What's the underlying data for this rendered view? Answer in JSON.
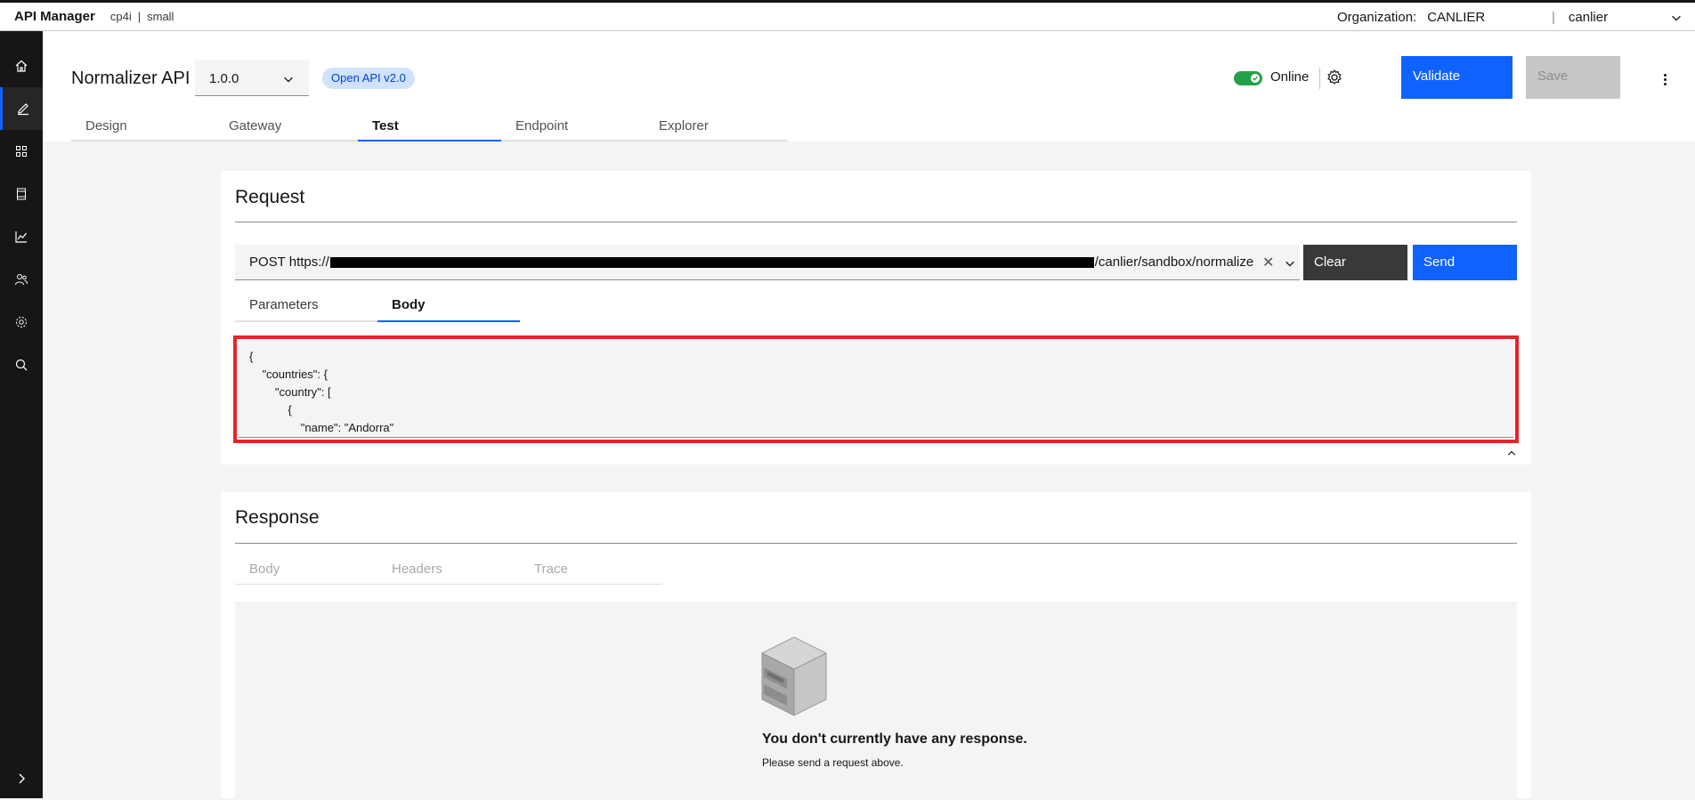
{
  "header": {
    "brand": "API Manager",
    "context": "cp4i",
    "context_sep": "|",
    "size": "small",
    "org_label": "Organization:",
    "org_value": "CANLIER",
    "user_sep": "|",
    "user": "canlier"
  },
  "rail": {
    "items": [
      "home-icon",
      "edit-icon",
      "apps-icon",
      "catalog-icon",
      "analytics-icon",
      "members-icon",
      "settings-icon",
      "search-icon"
    ],
    "active": "edit-icon",
    "expand": "chevron-right-icon"
  },
  "api": {
    "title": "Normalizer API",
    "version": "1.0.0",
    "spec_tag": "Open API v2.0",
    "status": "Online",
    "validate_label": "Validate",
    "save_label": "Save",
    "tabs": [
      "Design",
      "Gateway",
      "Test",
      "Endpoint",
      "Explorer"
    ],
    "active_tab": "Test"
  },
  "request": {
    "title": "Request",
    "url_prefix": "POST https://",
    "url_suffix": "/canlier/sandbox/normalizе",
    "clear_label": "Clear",
    "send_label": "Send",
    "tabs": [
      "Parameters",
      "Body"
    ],
    "active_tab": "Body",
    "body_lines": [
      "{",
      "    \"countries\": {",
      "        \"country\": [",
      "            {",
      "                \"name\": \"Andorra\""
    ]
  },
  "response": {
    "title": "Response",
    "tabs": [
      "Body",
      "Headers",
      "Trace"
    ],
    "empty_title": "You don't currently have any response.",
    "empty_sub": "Please send a request above."
  },
  "colors": {
    "accent": "#0f62fe",
    "online": "#24a148",
    "highlight": "#e8232a",
    "rail": "#161616"
  }
}
